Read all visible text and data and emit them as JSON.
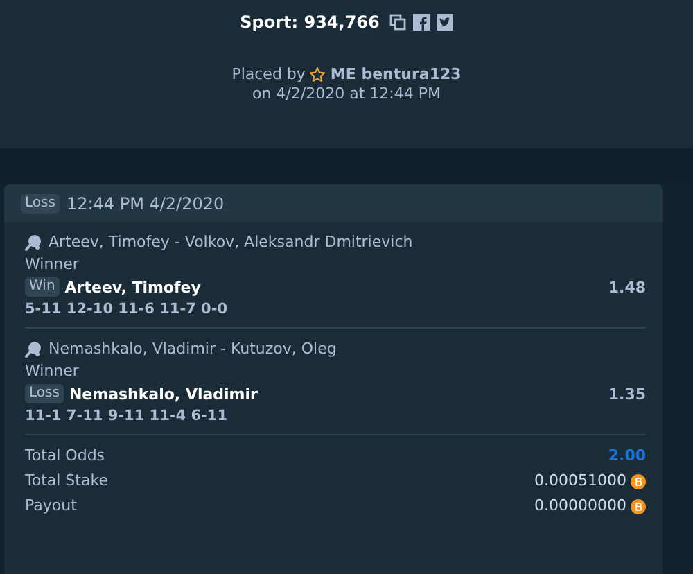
{
  "header": {
    "title": "Sport: 934,766",
    "placed_by_prefix": "Placed by",
    "user": "ME bentura123",
    "placed_on": "on 4/2/2020 at 12:44 PM"
  },
  "bet": {
    "status": "Loss",
    "time": "12:44 PM 4/2/2020",
    "legs": [
      {
        "event": "Arteev, Timofey - Volkov, Aleksandr Dmitrievich",
        "market": "Winner",
        "result": "Win",
        "selection": "Arteev, Timofey",
        "odds": "1.48",
        "score": "5-11 12-10 11-6 11-7 0-0"
      },
      {
        "event": "Nemashkalo, Vladimir - Kutuzov, Oleg",
        "market": "Winner",
        "result": "Loss",
        "selection": "Nemashkalo, Vladimir",
        "odds": "1.35",
        "score": "11-1 7-11 9-11 11-4 6-11"
      }
    ],
    "totals": [
      {
        "kind": "odds",
        "label": "Total Odds",
        "value": "2.00"
      },
      {
        "kind": "amount",
        "label": "Total Stake",
        "value": "0.00051000"
      },
      {
        "kind": "amount",
        "label": "Payout",
        "value": "0.00000000"
      }
    ]
  }
}
